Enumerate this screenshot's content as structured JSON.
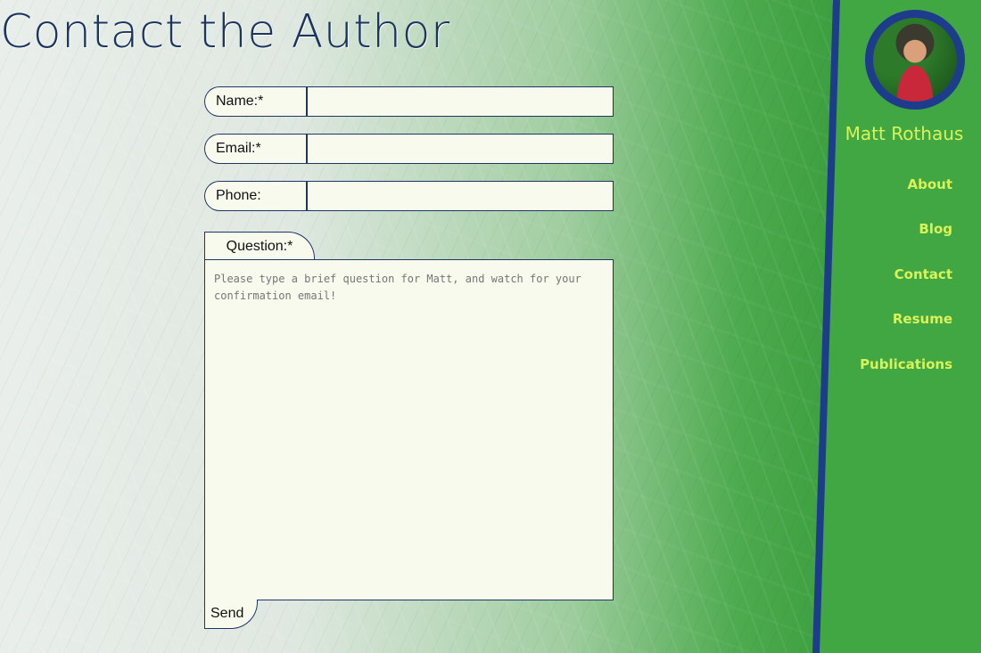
{
  "page": {
    "title": "Contact the Author"
  },
  "form": {
    "name_label": "Name:*",
    "email_label": "Email:*",
    "phone_label": "Phone:",
    "question_label": "Question:*",
    "question_placeholder": "Please type a brief question for Matt, and watch for your confirmation email!",
    "name_value": "",
    "email_value": "",
    "phone_value": "",
    "send_label": "Send"
  },
  "sidebar": {
    "author_name": "Matt Rothaus",
    "nav": [
      {
        "label": "About"
      },
      {
        "label": "Blog"
      },
      {
        "label": "Contact"
      },
      {
        "label": "Resume"
      },
      {
        "label": "Publications"
      }
    ]
  },
  "colors": {
    "title": "#1c3560",
    "accent_border": "#1e3c8c",
    "nav_text": "#d8f25a",
    "field_bg": "#f8faee",
    "sidebar_green": "#40a743"
  }
}
